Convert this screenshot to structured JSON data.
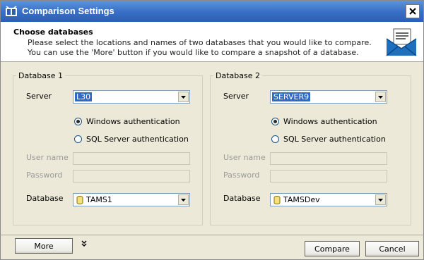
{
  "window": {
    "title": "Comparison Settings"
  },
  "header": {
    "title": "Choose databases",
    "description": "Please select the locations and names of two databases that you would like to compare. You can use the 'More' button if you would like to compare a snapshot of a database."
  },
  "db1": {
    "legend": "Database 1",
    "server_label": "Server",
    "server_value": "L30",
    "auth_windows": "Windows authentication",
    "auth_sql": "SQL Server authentication",
    "username_label": "User name",
    "password_label": "Password",
    "database_label": "Database",
    "database_value": "TAMS1"
  },
  "db2": {
    "legend": "Database 2",
    "server_label": "Server",
    "server_value": "SERVER9",
    "auth_windows": "Windows authentication",
    "auth_sql": "SQL Server authentication",
    "username_label": "User name",
    "password_label": "Password",
    "database_label": "Database",
    "database_value": "TAMSDev"
  },
  "buttons": {
    "more": "More",
    "compare": "Compare",
    "cancel": "Cancel"
  },
  "icons": {
    "title": "app-icon",
    "header": "envelope-icon",
    "close": "close-icon"
  }
}
